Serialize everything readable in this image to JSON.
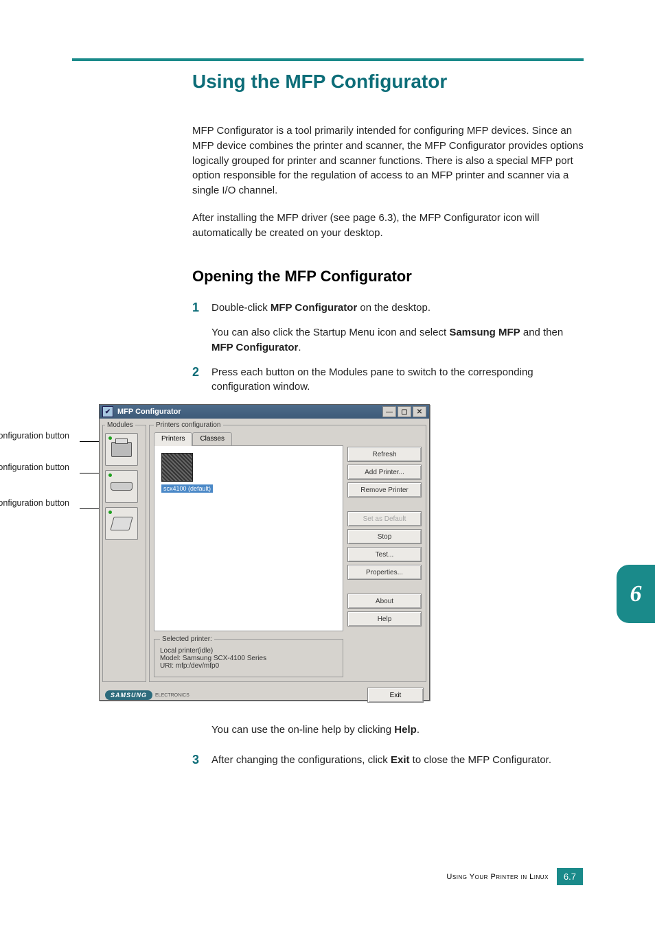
{
  "section_title": "Using the MFP Configurator",
  "intro_p1": "MFP Configurator is a tool primarily intended for configuring MFP devices. Since an MFP device combines the printer and scanner, the MFP Configurator provides options logically grouped for printer and scanner functions. There is also a special MFP port option responsible for the regulation of access to an MFP printer and scanner via a single I/O channel.",
  "intro_p2": "After installing the MFP driver (see page 6.3), the MFP Configurator icon will automatically be created on your desktop.",
  "subheading": "Opening the MFP Configurator",
  "steps": {
    "s1": {
      "num": "1",
      "line1_a": "Double-click ",
      "line1_b": "MFP Configurator",
      "line1_c": " on the desktop.",
      "line2_a": "You can also click the Startup Menu icon and select ",
      "line2_b": "Samsung MFP",
      "line2_c": " and then ",
      "line2_d": "MFP Configurator",
      "line2_e": "."
    },
    "s2": {
      "num": "2",
      "text": "Press each button on the Modules pane to switch to the corresponding configuration window.",
      "after_a": "You can use the on-line help by clicking ",
      "after_b": "Help",
      "after_c": "."
    },
    "s3": {
      "num": "3",
      "text_a": "After changing the configurations, click ",
      "text_b": "Exit",
      "text_c": " to close the MFP Configurator."
    }
  },
  "callouts": {
    "c1": "Printers Configuration button",
    "c2": "Scanners Configuration button",
    "c3": "MFP Ports Configuration button"
  },
  "window": {
    "title": "MFP Configurator",
    "modules_legend": "Modules",
    "pc_legend": "Printers configuration",
    "tab1": "Printers",
    "tab2": "Classes",
    "printer_label": "scx4100 (default)",
    "buttons": {
      "refresh": "Refresh",
      "add": "Add Printer...",
      "remove": "Remove Printer",
      "setdef": "Set as Default",
      "stop": "Stop",
      "test": "Test...",
      "props": "Properties...",
      "about": "About",
      "help": "Help"
    },
    "selected_legend": "Selected printer:",
    "selected_lines": {
      "l1": "Local printer(idle)",
      "l2": "Model: Samsung SCX-4100 Series",
      "l3": "URI: mfp:/dev/mfp0"
    },
    "brand": "SAMSUNG",
    "brand_sub": "ELECTRONICS",
    "exit": "Exit"
  },
  "page_tab": "6",
  "footer_text": "Using Your Printer in Linux",
  "page_number": "6.7"
}
